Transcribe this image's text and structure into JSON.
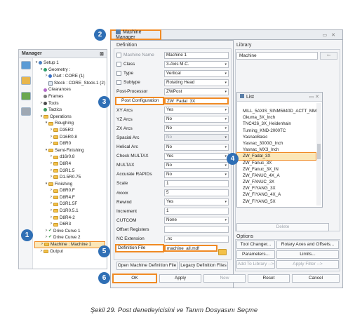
{
  "manager": {
    "title": "Manager",
    "close": "⊠",
    "tree": [
      {
        "label": "Setup 1",
        "indent": 0,
        "arrow": "▾",
        "kind": "dot",
        "color": "#4a7fc1"
      },
      {
        "label": "Geometry :",
        "indent": 1,
        "arrow": "▾",
        "kind": "dot",
        "color": "#2f9e6a"
      },
      {
        "label": "Part : CORE (1)",
        "indent": 2,
        "arrow": ">",
        "kind": "dot",
        "color": "#3b6fc4"
      },
      {
        "label": "Stock : CORE_Stock.1 (2)",
        "indent": 2,
        "arrow": "",
        "kind": "sq"
      },
      {
        "label": "Clearances",
        "indent": 1,
        "arrow": "",
        "kind": "dot",
        "color": "#b46ac9"
      },
      {
        "label": "Frames",
        "indent": 1,
        "arrow": "",
        "kind": "dot",
        "color": "#7a7a7a"
      },
      {
        "label": "Tools",
        "indent": 1,
        "arrow": ">",
        "kind": "dot",
        "color": "#4a4a4a"
      },
      {
        "label": "Tactics",
        "indent": 1,
        "arrow": "",
        "kind": "dot",
        "color": "#3c9a5f"
      },
      {
        "label": "Operations",
        "indent": 1,
        "arrow": "▾",
        "kind": "fold"
      },
      {
        "label": "Roughing",
        "indent": 2,
        "arrow": "▾",
        "kind": "fold"
      },
      {
        "label": "D35R2",
        "indent": 3,
        "arrow": ">",
        "kind": "fold"
      },
      {
        "label": "D16R0.8",
        "indent": 3,
        "arrow": ">",
        "kind": "fold"
      },
      {
        "label": "D8R0",
        "indent": 3,
        "arrow": ">",
        "kind": "fold"
      },
      {
        "label": "Semi-Finishing",
        "indent": 2,
        "arrow": "▾",
        "kind": "fold"
      },
      {
        "label": "d16r0.8",
        "indent": 3,
        "arrow": ">",
        "kind": "fold"
      },
      {
        "label": "D8R4",
        "indent": 3,
        "arrow": ">",
        "kind": "fold"
      },
      {
        "label": "D3R1.5",
        "indent": 3,
        "arrow": ">",
        "kind": "fold"
      },
      {
        "label": "D1.5R0.75",
        "indent": 3,
        "arrow": ">",
        "kind": "fold"
      },
      {
        "label": "Finishing",
        "indent": 2,
        "arrow": "▾",
        "kind": "fold"
      },
      {
        "label": "D8R0.F",
        "indent": 3,
        "arrow": ">",
        "kind": "fold"
      },
      {
        "label": "D8R4.F",
        "indent": 3,
        "arrow": ">",
        "kind": "fold"
      },
      {
        "label": "D3R1.5F",
        "indent": 3,
        "arrow": ">",
        "kind": "fold"
      },
      {
        "label": "D1R0.5.1",
        "indent": 3,
        "arrow": ">",
        "kind": "fold"
      },
      {
        "label": "D8R4-2",
        "indent": 3,
        "arrow": ">",
        "kind": "fold"
      },
      {
        "label": "D6R3",
        "indent": 3,
        "arrow": ">",
        "kind": "fold"
      },
      {
        "label": "Drive Curve 1",
        "indent": 2,
        "arrow": ">",
        "kind": "check"
      },
      {
        "label": "Drive Curve 2",
        "indent": 2,
        "arrow": ">",
        "kind": "check"
      },
      {
        "label": "Machine : Machine 1",
        "indent": 1,
        "arrow": ">",
        "kind": "fold",
        "highlight": true
      },
      {
        "label": "Output",
        "indent": 1,
        "arrow": ">",
        "kind": "fold"
      }
    ]
  },
  "dialog": {
    "title": "Machine Manager",
    "definition_label": "Definition",
    "library_label": "Library",
    "options_label": "Options",
    "rows": [
      {
        "label": "Machine Name",
        "value": "Machine 1",
        "checkbox": true,
        "disabled_label": true,
        "dropdown": false
      },
      {
        "label": "Class",
        "value": "3-Axis M.C.",
        "checkbox": true,
        "dropdown": true
      },
      {
        "label": "Type",
        "value": "Vertical",
        "checkbox": true,
        "dropdown": true
      },
      {
        "label": "Subtype",
        "value": "Rotating Head",
        "checkbox": true,
        "dropdown": true
      },
      {
        "label": "Post-Processor",
        "value": "ZWPost",
        "dropdown": true
      },
      {
        "label": "Post Configuration",
        "value": "ZW_Fadal_3X",
        "dropdown": false,
        "highlight": true
      },
      {
        "label": "XY Arcs",
        "value": "Yes",
        "dropdown": true
      },
      {
        "label": "YZ Arcs",
        "value": "No",
        "dropdown": true
      },
      {
        "label": "ZX Arcs",
        "value": "No",
        "dropdown": true
      },
      {
        "label": "Spacial Arc",
        "value": "No",
        "dropdown": true,
        "disabled": true
      },
      {
        "label": "Helical Arc",
        "value": "No",
        "dropdown": true
      },
      {
        "label": "Check MULTAX",
        "value": "Yes",
        "dropdown": true
      },
      {
        "label": "MULTAX",
        "value": "No",
        "dropdown": true
      },
      {
        "label": "Accurate RAPIDs",
        "value": "No",
        "dropdown": true
      },
      {
        "label": "Scale",
        "value": "1",
        "dropdown": false
      },
      {
        "label": "#xxxx",
        "value": "5",
        "dropdown": false
      },
      {
        "label": "Rewind",
        "value": "Yes",
        "dropdown": true
      },
      {
        "label": "Increment",
        "value": "1",
        "dropdown": false
      },
      {
        "label": "CUTCOM",
        "value": "None",
        "dropdown": true
      },
      {
        "label": "Offset Registers",
        "value": "",
        "dropdown": false
      },
      {
        "label": "NC Extension",
        "value": ".nc",
        "dropdown": false
      },
      {
        "label": "Definition File",
        "value": "machine_all.mdf",
        "dropdown": false,
        "highlight": true
      }
    ],
    "open_def_btn": "Open Machine Definition File",
    "legacy_btn": "Legacy Definition Files",
    "library_field": "Machine",
    "delete_btn": "Delete",
    "tool_changer_btn": "Tool Changer...",
    "rotary_btn": "Rotary Axes and Offsets...",
    "parameters_btn": "Parameters...",
    "limits_btn": "Limits...",
    "add_library_btn": "Add To Library -->",
    "apply_filter_btn": "Apply Filter -->",
    "ok_btn": "OK",
    "apply_btn": "Apply",
    "new_btn": "New",
    "reset_btn": "Reset",
    "cancel_btn": "Cancel"
  },
  "list_popup": {
    "title": "List",
    "items": [
      "MILL_5AXIS_SINM5840D_ACTT_MM",
      "Okuma_3X_Inch",
      "TNC426_3X_Heidenhain",
      "Turning_KND-2000TC",
      "YasnacBasic",
      "Yasnac_3000G_Inch",
      "Yasnac_MX3_Inch",
      "ZW_Fadal_3X",
      "ZW_Fanuc_3X",
      "ZW_Fanuc_3X_IN",
      "ZW_FANUC_4X_A",
      "ZW_FANUC_3X",
      "ZW_FIYANG_3X",
      "ZW_FIYANG_4X_A",
      "ZW_FIYANG_5X"
    ],
    "selected_index": 7
  },
  "badges": [
    "1",
    "2",
    "3",
    "4",
    "5",
    "6"
  ],
  "caption": "Şekil 29. Post denetleyicisini ve Tanım Dosyasını Seçme",
  "colors": {
    "accent": "#f08a24",
    "badge": "#2f6fb5"
  }
}
